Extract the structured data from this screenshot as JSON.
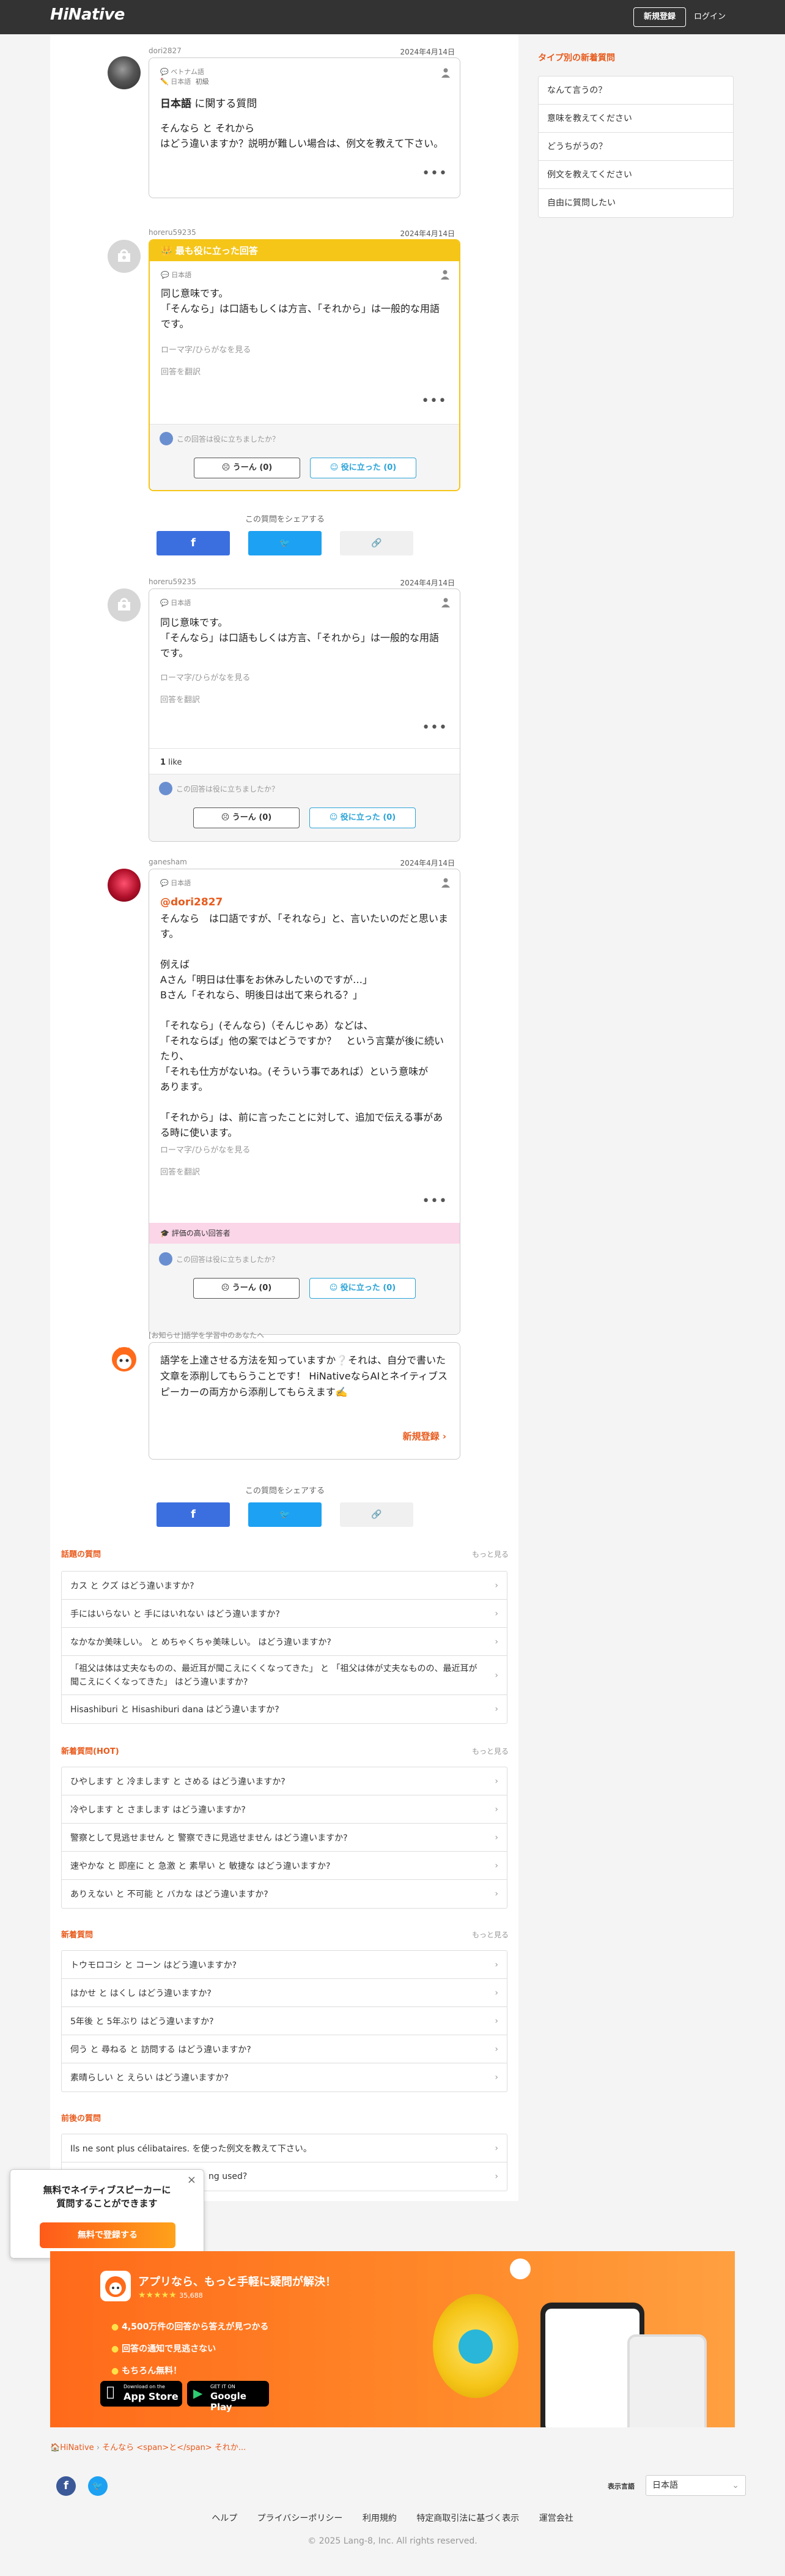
{
  "header": {
    "logo": "HiNative",
    "register": "新規登録",
    "login": "ログイン"
  },
  "sidebar": {
    "title": "タイプ別の新着質問",
    "items": [
      "なんて言うの？",
      "意味を教えてください",
      "どうちがうの？",
      "例文を教えてください",
      "自由に質問したい"
    ]
  },
  "question": {
    "user": "dori2827",
    "date": "2024年4月14日",
    "native_lang": "ベトナム語",
    "learning_lang": "日本語",
    "learning_level": "初級",
    "title_lang": "日本語",
    "title_suffix": " に関する質問",
    "body_line1": "そんなら と それから",
    "body_line2": "はどう違いますか？説明が難しい場合は、例文を教えて下さい。"
  },
  "answers": [
    {
      "user": "horeru59235",
      "date": "2024年4月14日",
      "best_label": "最も役に立った回答",
      "lang": "日本語",
      "text1": "同じ意味です。",
      "text2": "「そんなら」は口語もしくは方言、「それから」は一般的な用語です。",
      "romaji": "ローマ字/ひらがなを見る",
      "translate": "回答を翻訳",
      "vote_question": "この回答は役に立ちましたか？",
      "hmm": "うーん (0)",
      "useful": "役に立った (0)"
    },
    {
      "user": "horeru59235",
      "date": "2024年4月14日",
      "lang": "日本語",
      "text1": "同じ意味です。",
      "text2": "「そんなら」は口語もしくは方言、「それから」は一般的な用語です。",
      "romaji": "ローマ字/ひらがなを見る",
      "translate": "回答を翻訳",
      "likes": "1",
      "likes_label": " like",
      "vote_question": "この回答は役に立ちましたか？",
      "hmm": "うーん (0)",
      "useful": "役に立った (0)"
    },
    {
      "user": "ganesham",
      "date": "2024年4月14日",
      "lang": "日本語",
      "mention": "@dori2827",
      "lines": [
        "そんなら　は口語ですが、「それなら」と、言いたいのだと思いま",
        "す。",
        "",
        "例えば",
        "Aさん「明日は仕事をお休みしたいのですが…」",
        "Bさん「それなら、明後日は出て来られる？」",
        "",
        "「それなら」(そんなら)（そんじゃあ）などは、",
        "「それならば」他の案ではどうですか？　という言葉が後に続い",
        "たり、",
        "「それも仕方がないね。(そういう事であれば）という意味が",
        "あります。",
        "",
        "「それから」は、前に言ったことに対して、追加で伝える事があ",
        "る時に使います。"
      ],
      "romaji": "ローマ字/ひらがなを見る",
      "translate": "回答を翻訳",
      "badge": "評価の高い回答者",
      "vote_question": "この回答は役に立ちましたか？",
      "hmm": "うーん (0)",
      "useful": "役に立った (0)"
    }
  ],
  "ad_block": {
    "label": "[お知らせ]語学を学習中のあなたへ",
    "text": "語学を上達させる方法を知っていますか❔それは、自分で書いた文章を添削してもらうことです！ HiNativeならAIとネイティブスピーカーの両方から添削してもらえます✍️",
    "cta": "新規登録"
  },
  "share": {
    "label": "この質問をシェアする",
    "fb": "f",
    "tw": "🐦",
    "link": "🔗"
  },
  "sections": [
    {
      "title": "話題の質問",
      "more": "もっと見る",
      "items": [
        "カス と クズ はどう違いますか?",
        "手にはいらない と 手にはいれない はどう違いますか?",
        "なかなか美味しい。 と めちゃくちゃ美味しい。 はどう違いますか?",
        "「祖父は体は丈夫なものの、最近耳が聞こえにくくなってきた」 と 「祖父は体が丈夫なものの、最近耳が聞こえにくくなってきた」 はどう違いますか?",
        "Hisashiburi と Hisashiburi dana はどう違いますか?"
      ]
    },
    {
      "title": "新着質問(HOT)",
      "more": "もっと見る",
      "items": [
        "ひやします と 冷まします と さめる はどう違いますか?",
        "冷やします と さまします はどう違いますか?",
        "警察として見逃せません と 警察できに見逃せません はどう違いますか?",
        "速やかな と 即座に と 急激 と 素早い と 敏捷な はどう違いますか?",
        "ありえない と 不可能 と バカな はどう違いますか?"
      ]
    },
    {
      "title": "新着質問",
      "more": "もっと見る",
      "items": [
        "トウモロコシ と コーン はどう違いますか?",
        "はかせ と はくし はどう違いますか?",
        "5年後 と 5年ぶり はどう違いますか?",
        "伺う と 尋ねる と 訪問する はどう違いますか?",
        "素晴らしい と えらい はどう違いますか?"
      ]
    },
    {
      "title": "前後の質問",
      "items": [
        "Ils ne sont plus célibataires. を使った例文を教えて下さい。",
        "ng used?"
      ]
    }
  ],
  "popup": {
    "line1": "無料でネイティブスピーカーに",
    "line2": "質問することができます",
    "button": "無料で登録する",
    "close": "×"
  },
  "promo": {
    "title": "アプリなら、もっと手軽に疑問が解決！",
    "stars": "★★★★★",
    "rating_count": "35,688",
    "bullets": [
      "4,500万件の回答から答えが見つかる",
      "回答の通知で見逃さない",
      "もちろん無料！"
    ],
    "appstore_small": "Download on the",
    "appstore": "App Store",
    "play_small": "GET IT ON",
    "play": "Google Play"
  },
  "breadcrumb": {
    "home": "HiNative",
    "current": "そんなら <span>と</span> それか..."
  },
  "footer": {
    "lang_label": "表示言語",
    "lang_value": "日本語",
    "links": [
      "ヘルプ",
      "プライバシーポリシー",
      "利用規約",
      "特定商取引法に基づく表示",
      "運営会社"
    ],
    "copyright": "© 2025 Lang-8, Inc. All rights reserved."
  }
}
